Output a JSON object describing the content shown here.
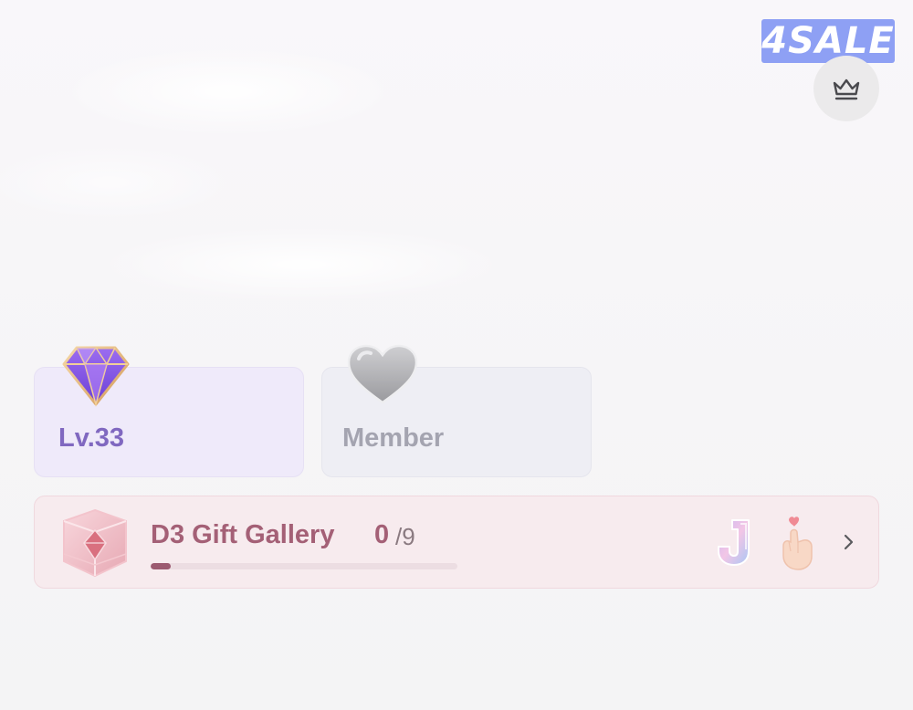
{
  "sale_badge": {
    "label": "4SALE",
    "color": "#8ea0f4"
  },
  "header": {
    "crown_button_icon": "crown-icon"
  },
  "level_card": {
    "label": "Lv.33",
    "icon": "diamond-icon",
    "accent": "#8068c0"
  },
  "member_card": {
    "label": "Member",
    "icon": "heart-icon",
    "accent": "#a4a4b0"
  },
  "gallery": {
    "title": "D3 Gift Gallery",
    "count": "0",
    "total": "/9",
    "progress": 0.065,
    "icon": "gallery-cube-icon",
    "gift_icons": [
      "letter-j-icon",
      "finger-heart-icon"
    ],
    "accent": "#a46076",
    "chevron_icon": "chevron-right-icon"
  }
}
